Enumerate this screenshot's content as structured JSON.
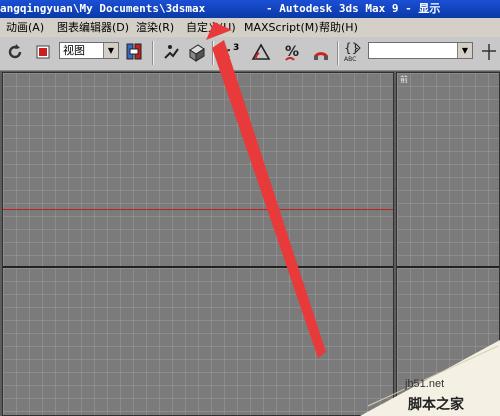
{
  "window": {
    "title_path": "angqingyuan\\My Documents\\3dsmax",
    "title_app": "- Autodesk 3ds Max 9    - 显示"
  },
  "menu": {
    "items": [
      {
        "label": "动画(A)"
      },
      {
        "label": "图表编辑器(D)"
      },
      {
        "label": "渲染(R)"
      },
      {
        "label": "自定义(U)"
      },
      {
        "label": "MAXScript(M)"
      },
      {
        "label": "帮助(H)"
      }
    ]
  },
  "toolbar": {
    "view_combo": {
      "value": "视图"
    },
    "selection_set_combo": {
      "value": ""
    },
    "icons": [
      "rotate-icon",
      "select-region-icon",
      "use-pivot-icon",
      "select-manipulate-icon",
      "snap-toggle-icon",
      "angle-snap-icon",
      "percent-snap-icon",
      "spinner-snap-icon",
      "named-selection-icon"
    ]
  },
  "viewport": {
    "right_label": "前"
  },
  "watermark": {
    "site": "jb51.net",
    "text": "脚本之家"
  },
  "colors": {
    "title_bar": "#0a3aa6",
    "arrow": "#e83a3a",
    "axis_red": "#c02020"
  }
}
